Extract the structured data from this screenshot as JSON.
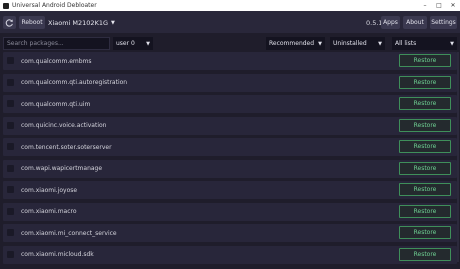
{
  "window": {
    "title": "Universal Android Debloater"
  },
  "toolbar": {
    "reboot_label": "Reboot",
    "device_label": "Xiaomi M2102K1G",
    "version": "0.5.1",
    "apps_label": "Apps",
    "about_label": "About",
    "settings_label": "Settings"
  },
  "filters": {
    "search_placeholder": "Search packages...",
    "user_selected": "user 0",
    "recommendation_selected": "Recommended",
    "state_selected": "Uninstalled",
    "list_selected": "All lists"
  },
  "packages": [
    {
      "name": "com.qualcomm.embms",
      "action": "Restore"
    },
    {
      "name": "com.qualcomm.qti.autoregistration",
      "action": "Restore"
    },
    {
      "name": "com.qualcomm.qti.uim",
      "action": "Restore"
    },
    {
      "name": "com.quicinc.voice.activation",
      "action": "Restore"
    },
    {
      "name": "com.tencent.soter.soterserver",
      "action": "Restore"
    },
    {
      "name": "com.wapi.wapicertmanage",
      "action": "Restore"
    },
    {
      "name": "com.xiaomi.joyose",
      "action": "Restore"
    },
    {
      "name": "com.xiaomi.macro",
      "action": "Restore"
    },
    {
      "name": "com.xiaomi.mi_connect_service",
      "action": "Restore"
    },
    {
      "name": "com.xiaomi.micloud.sdk",
      "action": "Restore"
    }
  ],
  "colors": {
    "background": "#1f1d2b",
    "row": "#28263a",
    "restore_accent": "#6ed092"
  },
  "icons": {
    "refresh": "refresh-icon",
    "app": "app-icon"
  }
}
